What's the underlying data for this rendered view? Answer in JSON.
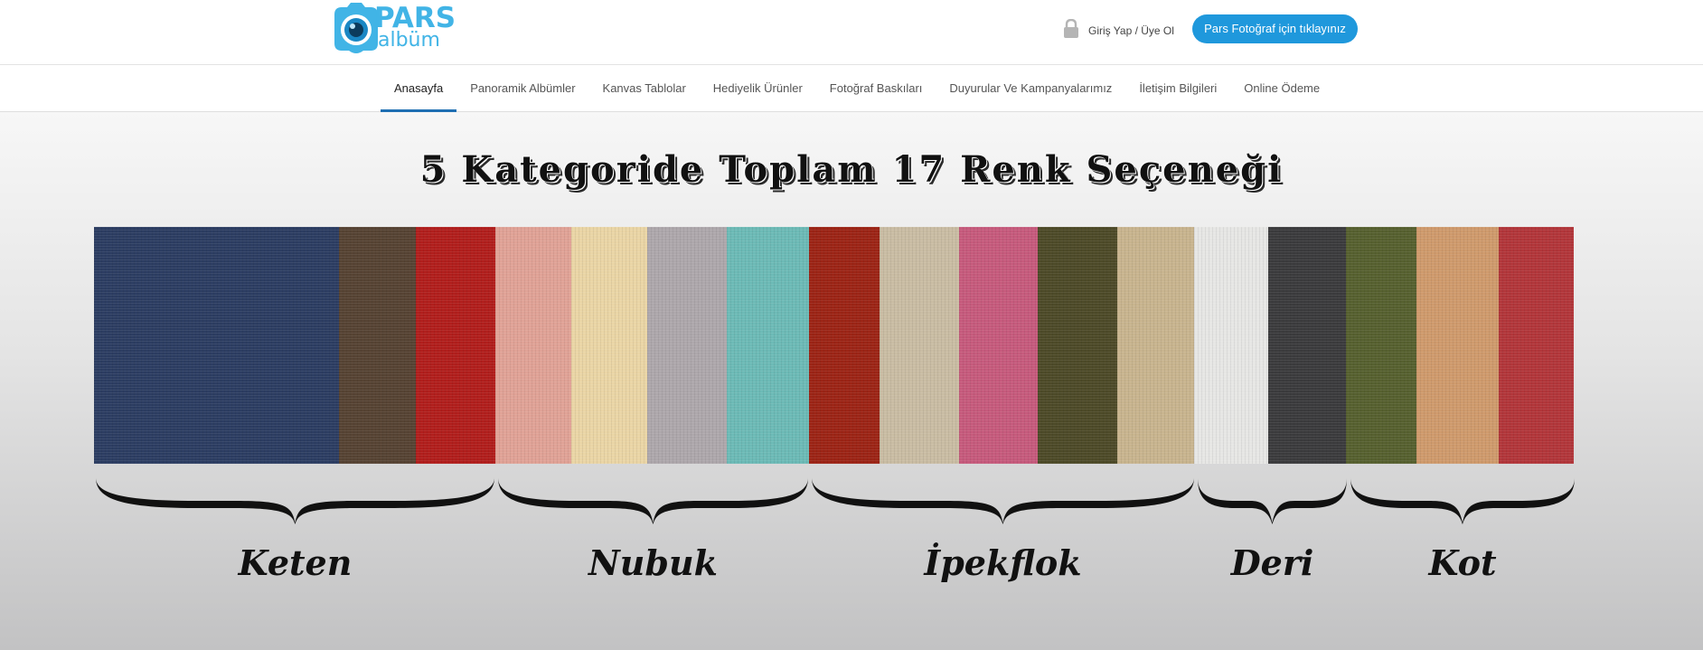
{
  "brand": {
    "name": "PARS",
    "subname": "albüm",
    "color": "#41b4e6"
  },
  "header": {
    "login_label": "Giriş Yap / Üye Ol",
    "login_icon": "lock-icon",
    "cta_label": "Pars Fotoğraf için tıklayınız",
    "cta_color": "#1f98dc"
  },
  "nav": {
    "active_index": 0,
    "items": [
      "Anasayfa",
      "Panoramik Albümler",
      "Kanvas Tablolar",
      "Hediyelik Ürünler",
      "Fotoğraf Baskıları",
      "Duyurular Ve Kampanyalarımız",
      "İletişim Bilgileri",
      "Online Ödeme"
    ]
  },
  "banner": {
    "title": "5 Kategoride Toplam 17 Renk Seçeneği",
    "swatches": [
      {
        "color": "#2c3d62",
        "category": "Keten"
      },
      {
        "color": "#564333",
        "category": "Keten"
      },
      {
        "color": "#b11e1c",
        "category": "Keten"
      },
      {
        "color": "#e0a296",
        "category": "Nubuk"
      },
      {
        "color": "#ead5a5",
        "category": "Nubuk"
      },
      {
        "color": "#ada7ab",
        "category": "Nubuk"
      },
      {
        "color": "#6cbab6",
        "category": "Nubuk"
      },
      {
        "color": "#9c2415",
        "category": "İpekflok"
      },
      {
        "color": "#c9bca3",
        "category": "İpekflok"
      },
      {
        "color": "#c65a7c",
        "category": "İpekflok"
      },
      {
        "color": "#4d4a28",
        "category": "İpekflok"
      },
      {
        "color": "#c8b48e",
        "category": "İpekflok"
      },
      {
        "color": "#e6e6e4",
        "category": "Deri"
      },
      {
        "color": "#3b3b3d",
        "category": "Deri"
      },
      {
        "color": "#56602f",
        "category": "Kot"
      },
      {
        "color": "#cf9a6c",
        "category": "Kot"
      },
      {
        "color": "#b2363a",
        "category": "Kot"
      }
    ],
    "categories": [
      "Keten",
      "Nubuk",
      "İpekflok",
      "Deri",
      "Kot"
    ]
  }
}
